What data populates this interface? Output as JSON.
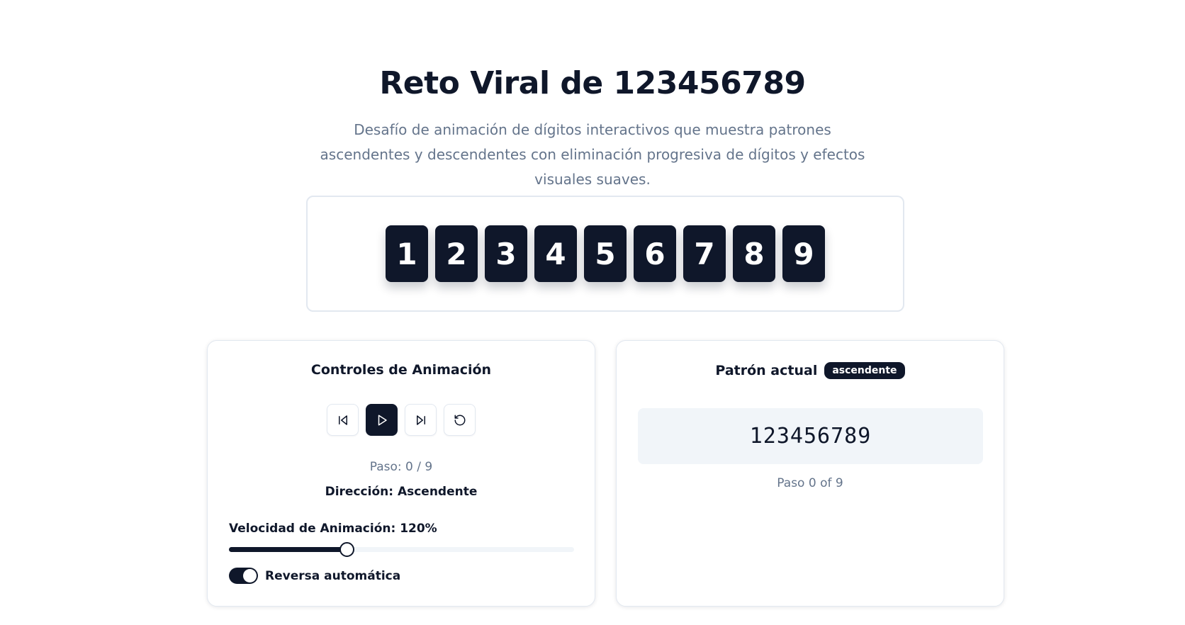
{
  "header": {
    "title": "Reto Viral de 123456789",
    "subtitle": "Desafío de animación de dígitos interactivos que muestra patrones ascendentes y descendentes con eliminación progresiva de dígitos y efectos visuales suaves."
  },
  "digits": [
    "1",
    "2",
    "3",
    "4",
    "5",
    "6",
    "7",
    "8",
    "9"
  ],
  "controls": {
    "title": "Controles de Animación",
    "buttons": [
      {
        "name": "previous-step",
        "icon": "skip-back-icon"
      },
      {
        "name": "play",
        "icon": "play-icon"
      },
      {
        "name": "next-step",
        "icon": "skip-forward-icon"
      },
      {
        "name": "reset",
        "icon": "rotate-ccw-icon"
      }
    ],
    "step": "Paso: 0 / 9",
    "direction": "Dirección: Ascendente",
    "speed_label": "Velocidad de Animación: 120%",
    "speed_fraction": 0.34,
    "auto_reverse_label": "Reversa automática",
    "auto_reverse_on": true
  },
  "pattern": {
    "title": "Patrón actual",
    "badge": "ascendente",
    "value": "123456789",
    "step": "Paso 0 of 9"
  },
  "colors": {
    "accent": "#0f172a",
    "muted_text": "#64748b",
    "border": "#e2e8f0",
    "surface": "#f1f5f9"
  }
}
